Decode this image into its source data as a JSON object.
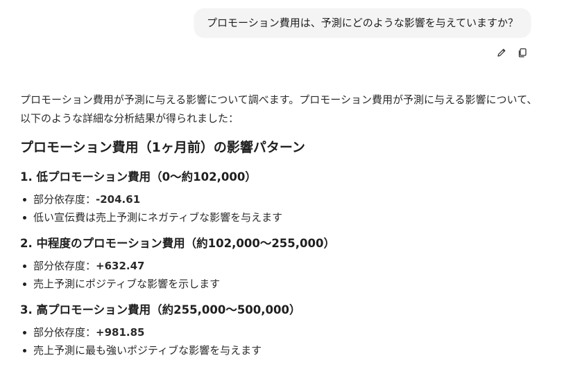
{
  "user_message": "プロモーション費用は、予測にどのような影響を与えていますか？",
  "actions": {
    "edit_icon": "pencil-icon",
    "copy_icon": "copy-icon"
  },
  "response": {
    "intro": "プロモーション費用が予測に与える影響について調べます。プロモーション費用が予測に与える影響について、以下のような詳細な分析結果が得られました：",
    "heading": "プロモーション費用（1ヶ月前）の影響パターン",
    "sections": [
      {
        "title": "1. 低プロモーション費用（0〜約102,000）",
        "dependency_label": "部分依存度：",
        "dependency_value": "-204.61",
        "note": "低い宣伝費は売上予測にネガティブな影響を与えます"
      },
      {
        "title": "2. 中程度のプロモーション費用（約102,000〜255,000）",
        "dependency_label": "部分依存度：",
        "dependency_value": "+632.47",
        "note": "売上予測にポジティブな影響を示します"
      },
      {
        "title": "3. 高プロモーション費用（約255,000〜500,000）",
        "dependency_label": "部分依存度：",
        "dependency_value": "+981.85",
        "note": "売上予測に最も強いポジティブな影響を与えます"
      }
    ]
  }
}
